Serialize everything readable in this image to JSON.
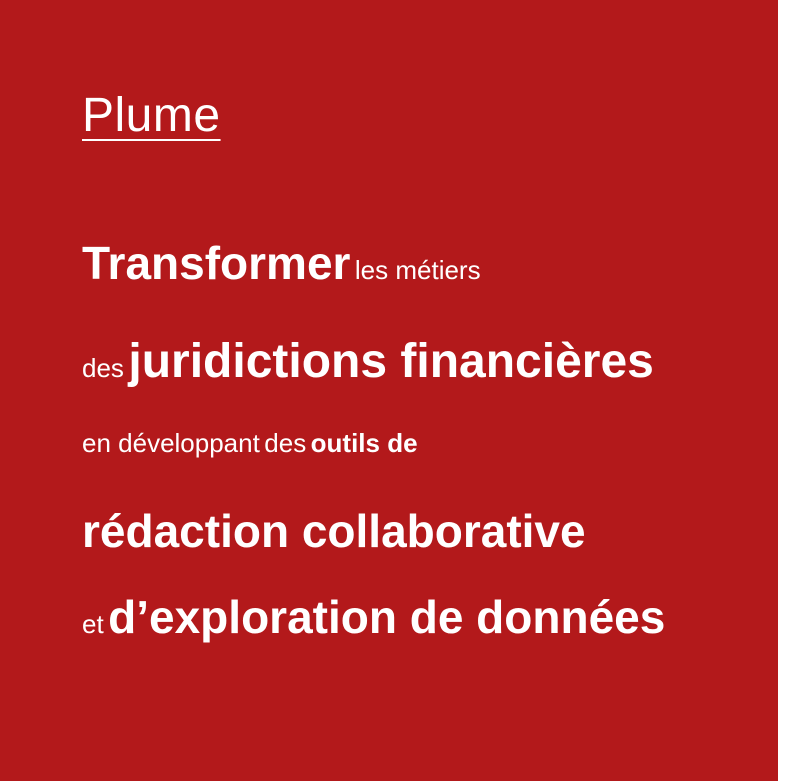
{
  "title": "Plume",
  "lines": {
    "line1": {
      "bold": "Transformer",
      "normal": "les métiers"
    },
    "line2": {
      "normal": "des",
      "bold": "juridictions financières"
    },
    "line3": {
      "normal_a": "en développant",
      "normal_b": "des",
      "bold": "outils de"
    },
    "line4": {
      "bold": "rédaction collaborative"
    },
    "line5": {
      "normal": "et",
      "bold": "d’exploration de données"
    }
  },
  "colors": {
    "background": "#b3191b",
    "text": "#ffffff"
  }
}
